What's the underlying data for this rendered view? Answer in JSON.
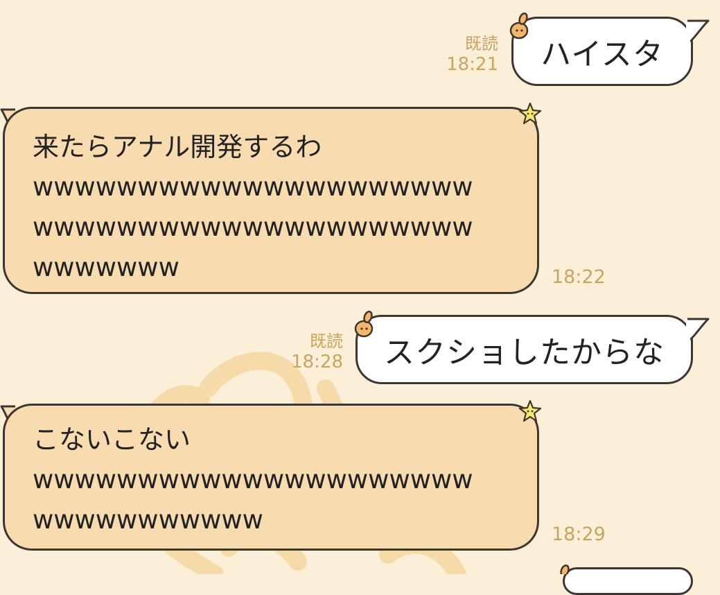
{
  "colors": {
    "background": "#fcefd8",
    "sent_bubble": "#ffffff",
    "received_bubble": "#f8dcb0",
    "bubble_border": "#3d3530",
    "meta_text": "#c9a461"
  },
  "messages": [
    {
      "direction": "sent",
      "read_label": "既読",
      "time": "18:21",
      "text": "ハイスタ",
      "decoration": "rabbit-icon"
    },
    {
      "direction": "received",
      "time": "18:22",
      "lines": [
        "来たらアナル開発するわ",
        "wwwwwwwwwwwwwwwwwwwww",
        "wwwwwwwwwwwwwwwwwwwww",
        "wwwwwww"
      ],
      "decoration": "star-icon"
    },
    {
      "direction": "sent",
      "read_label": "既読",
      "time": "18:28",
      "text": "スクショしたからな",
      "decoration": "rabbit-icon"
    },
    {
      "direction": "received",
      "time": "18:29",
      "lines": [
        "こないこない",
        "wwwwwwwwwwwwwwwwwwwww",
        "wwwwwwwwwww"
      ],
      "decoration": "star-icon"
    }
  ]
}
